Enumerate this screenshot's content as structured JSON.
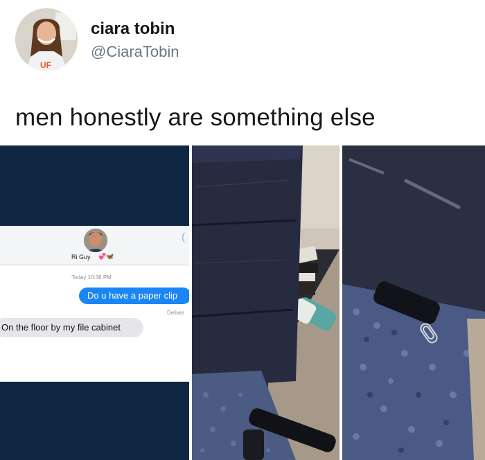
{
  "tweet": {
    "display_name": "ciara tobin",
    "handle": "@CiaraTobin",
    "text": "men honestly are something else",
    "avatar_icon": "profile-photo",
    "avatar_shirt_text": "UF"
  },
  "chat": {
    "contact_name": "Ri Guy",
    "contact_emoji": "💞🦋",
    "timestamp": "Today 10:38 PM",
    "sent_message": "Do u have a paper clip",
    "delivered_label": "Deliver",
    "received_message": "On the floor by my file cabinet",
    "back_icon": "chevron-left-icon"
  },
  "colors": {
    "ios_blue": "#1a86f6",
    "received_bubble": "#e6e6ea",
    "cabinet_navy": "#252a3d",
    "carpet_blue": "#4a5a86",
    "paper_clip": "#cfd6dc"
  }
}
